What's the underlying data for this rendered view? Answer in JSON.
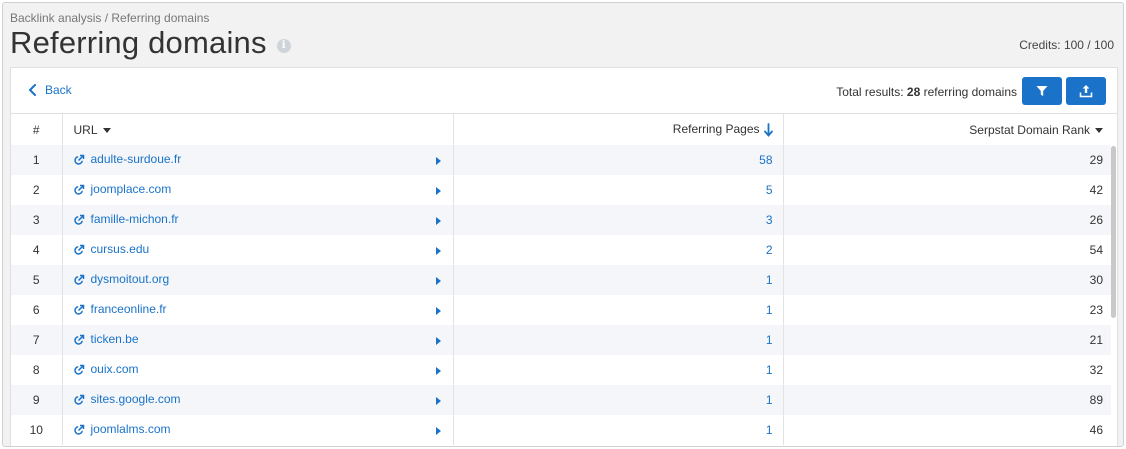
{
  "header": {
    "breadcrumb": "Backlink analysis / Referring domains",
    "title": "Referring domains",
    "info_glyph": "i",
    "credits": "Credits: 100 / 100"
  },
  "toolbar": {
    "back_label": "Back",
    "total_prefix": "Total results: ",
    "total_count": "28",
    "total_suffix": " referring domains",
    "filter_icon": "filter-icon",
    "export_icon": "upload-icon",
    "accent": "#1a73c9"
  },
  "table": {
    "headers": {
      "num": "#",
      "url": "URL",
      "ref": "Referring Pages",
      "rank": "Serpstat Domain Rank"
    },
    "rows": [
      {
        "num": "1",
        "domain": "adulte-surdoue.fr",
        "ref": "58",
        "rank": "29"
      },
      {
        "num": "2",
        "domain": "joomplace.com",
        "ref": "5",
        "rank": "42"
      },
      {
        "num": "3",
        "domain": "famille-michon.fr",
        "ref": "3",
        "rank": "26"
      },
      {
        "num": "4",
        "domain": "cursus.edu",
        "ref": "2",
        "rank": "54"
      },
      {
        "num": "5",
        "domain": "dysmoitout.org",
        "ref": "1",
        "rank": "30"
      },
      {
        "num": "6",
        "domain": "franceonline.fr",
        "ref": "1",
        "rank": "23"
      },
      {
        "num": "7",
        "domain": "ticken.be",
        "ref": "1",
        "rank": "21"
      },
      {
        "num": "8",
        "domain": "ouix.com",
        "ref": "1",
        "rank": "32"
      },
      {
        "num": "9",
        "domain": "sites.google.com",
        "ref": "1",
        "rank": "89"
      },
      {
        "num": "10",
        "domain": "joomlalms.com",
        "ref": "1",
        "rank": "46"
      }
    ]
  }
}
